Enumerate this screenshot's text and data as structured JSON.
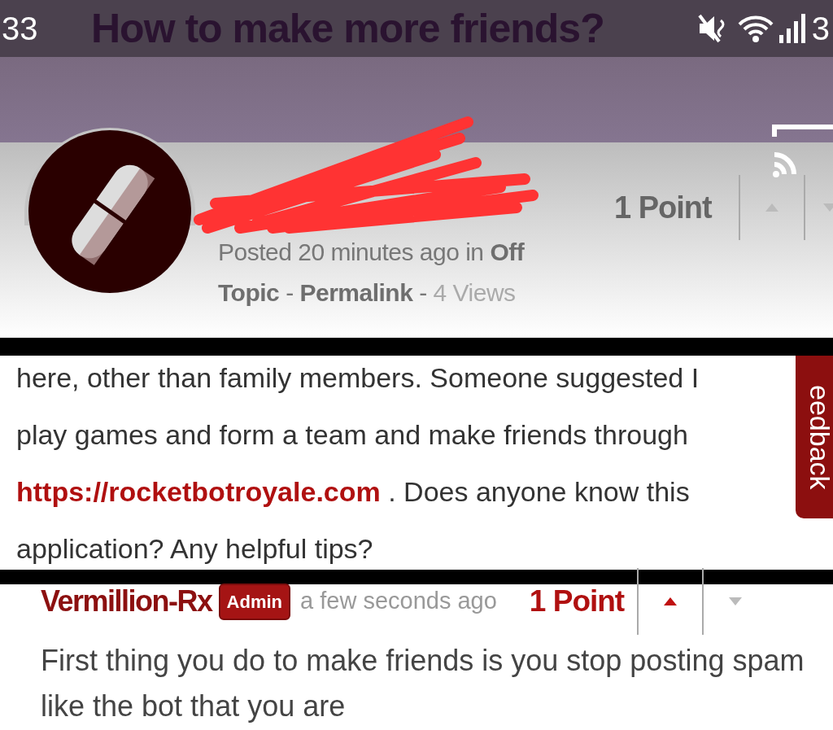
{
  "status_bar": {
    "time": "33",
    "battery": "3"
  },
  "title": "How to make more friends?",
  "post": {
    "posted": "Posted 20 minutes ago in",
    "category": "Off Topic",
    "separator_1": "-",
    "permalink": "Permalink",
    "separator_2": "-",
    "views": "4 Views",
    "points": "1 Point",
    "upvoted": false,
    "body_before": "here, other than family members. Someone suggested I play games and form a team and make friends through",
    "link": "https://rocketbotroyale.com",
    "body_after": " . Does anyone know this application? Any helpful tips?"
  },
  "feedback_tab": "eedback",
  "comment": {
    "author": "Vermillion-Rx",
    "badge": "Admin",
    "time": "a few seconds ago",
    "points": "1 Point",
    "upvoted": true,
    "text": "First thing you do to make friends is you stop posting spam like the bot that you are"
  }
}
